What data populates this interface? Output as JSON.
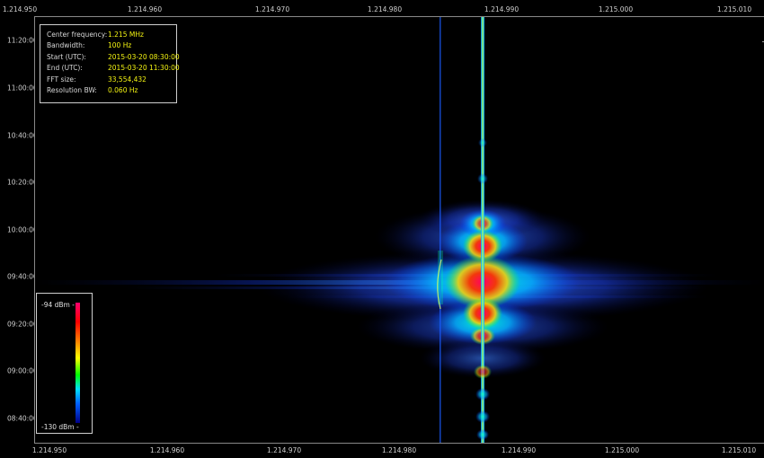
{
  "x_axis": {
    "labels": [
      "1.214.950",
      "1.214.960",
      "1.214.970",
      "1.214.980",
      "1.214.990",
      "1.215.000",
      "1.215.010"
    ]
  },
  "y_axis": {
    "labels": [
      "11:20:00",
      "11:00:00",
      "10:40:00",
      "10:20:00",
      "10:00:00",
      "09:40:00",
      "09:20:00",
      "09:00:00",
      "08:40:00"
    ]
  },
  "info": {
    "rows": [
      {
        "key": "Center frequency:",
        "value": "1.215 MHz"
      },
      {
        "key": "Bandwidth:",
        "value": "100 Hz"
      },
      {
        "key": "Start (UTC):",
        "value": "2015-03-20 08:30:00"
      },
      {
        "key": "End (UTC):",
        "value": "2015-03-20 11:30:00"
      },
      {
        "key": "FFT size:",
        "value": "33,554,432"
      },
      {
        "key": "Resolution BW:",
        "value": "0.060 Hz"
      }
    ]
  },
  "legend": {
    "max_label": "-94 dBm -",
    "min_label": "-130 dBm -"
  },
  "colors": {
    "background": "#000000",
    "info_value": "#f3f312",
    "axis_text": "#cfcfcf"
  }
}
